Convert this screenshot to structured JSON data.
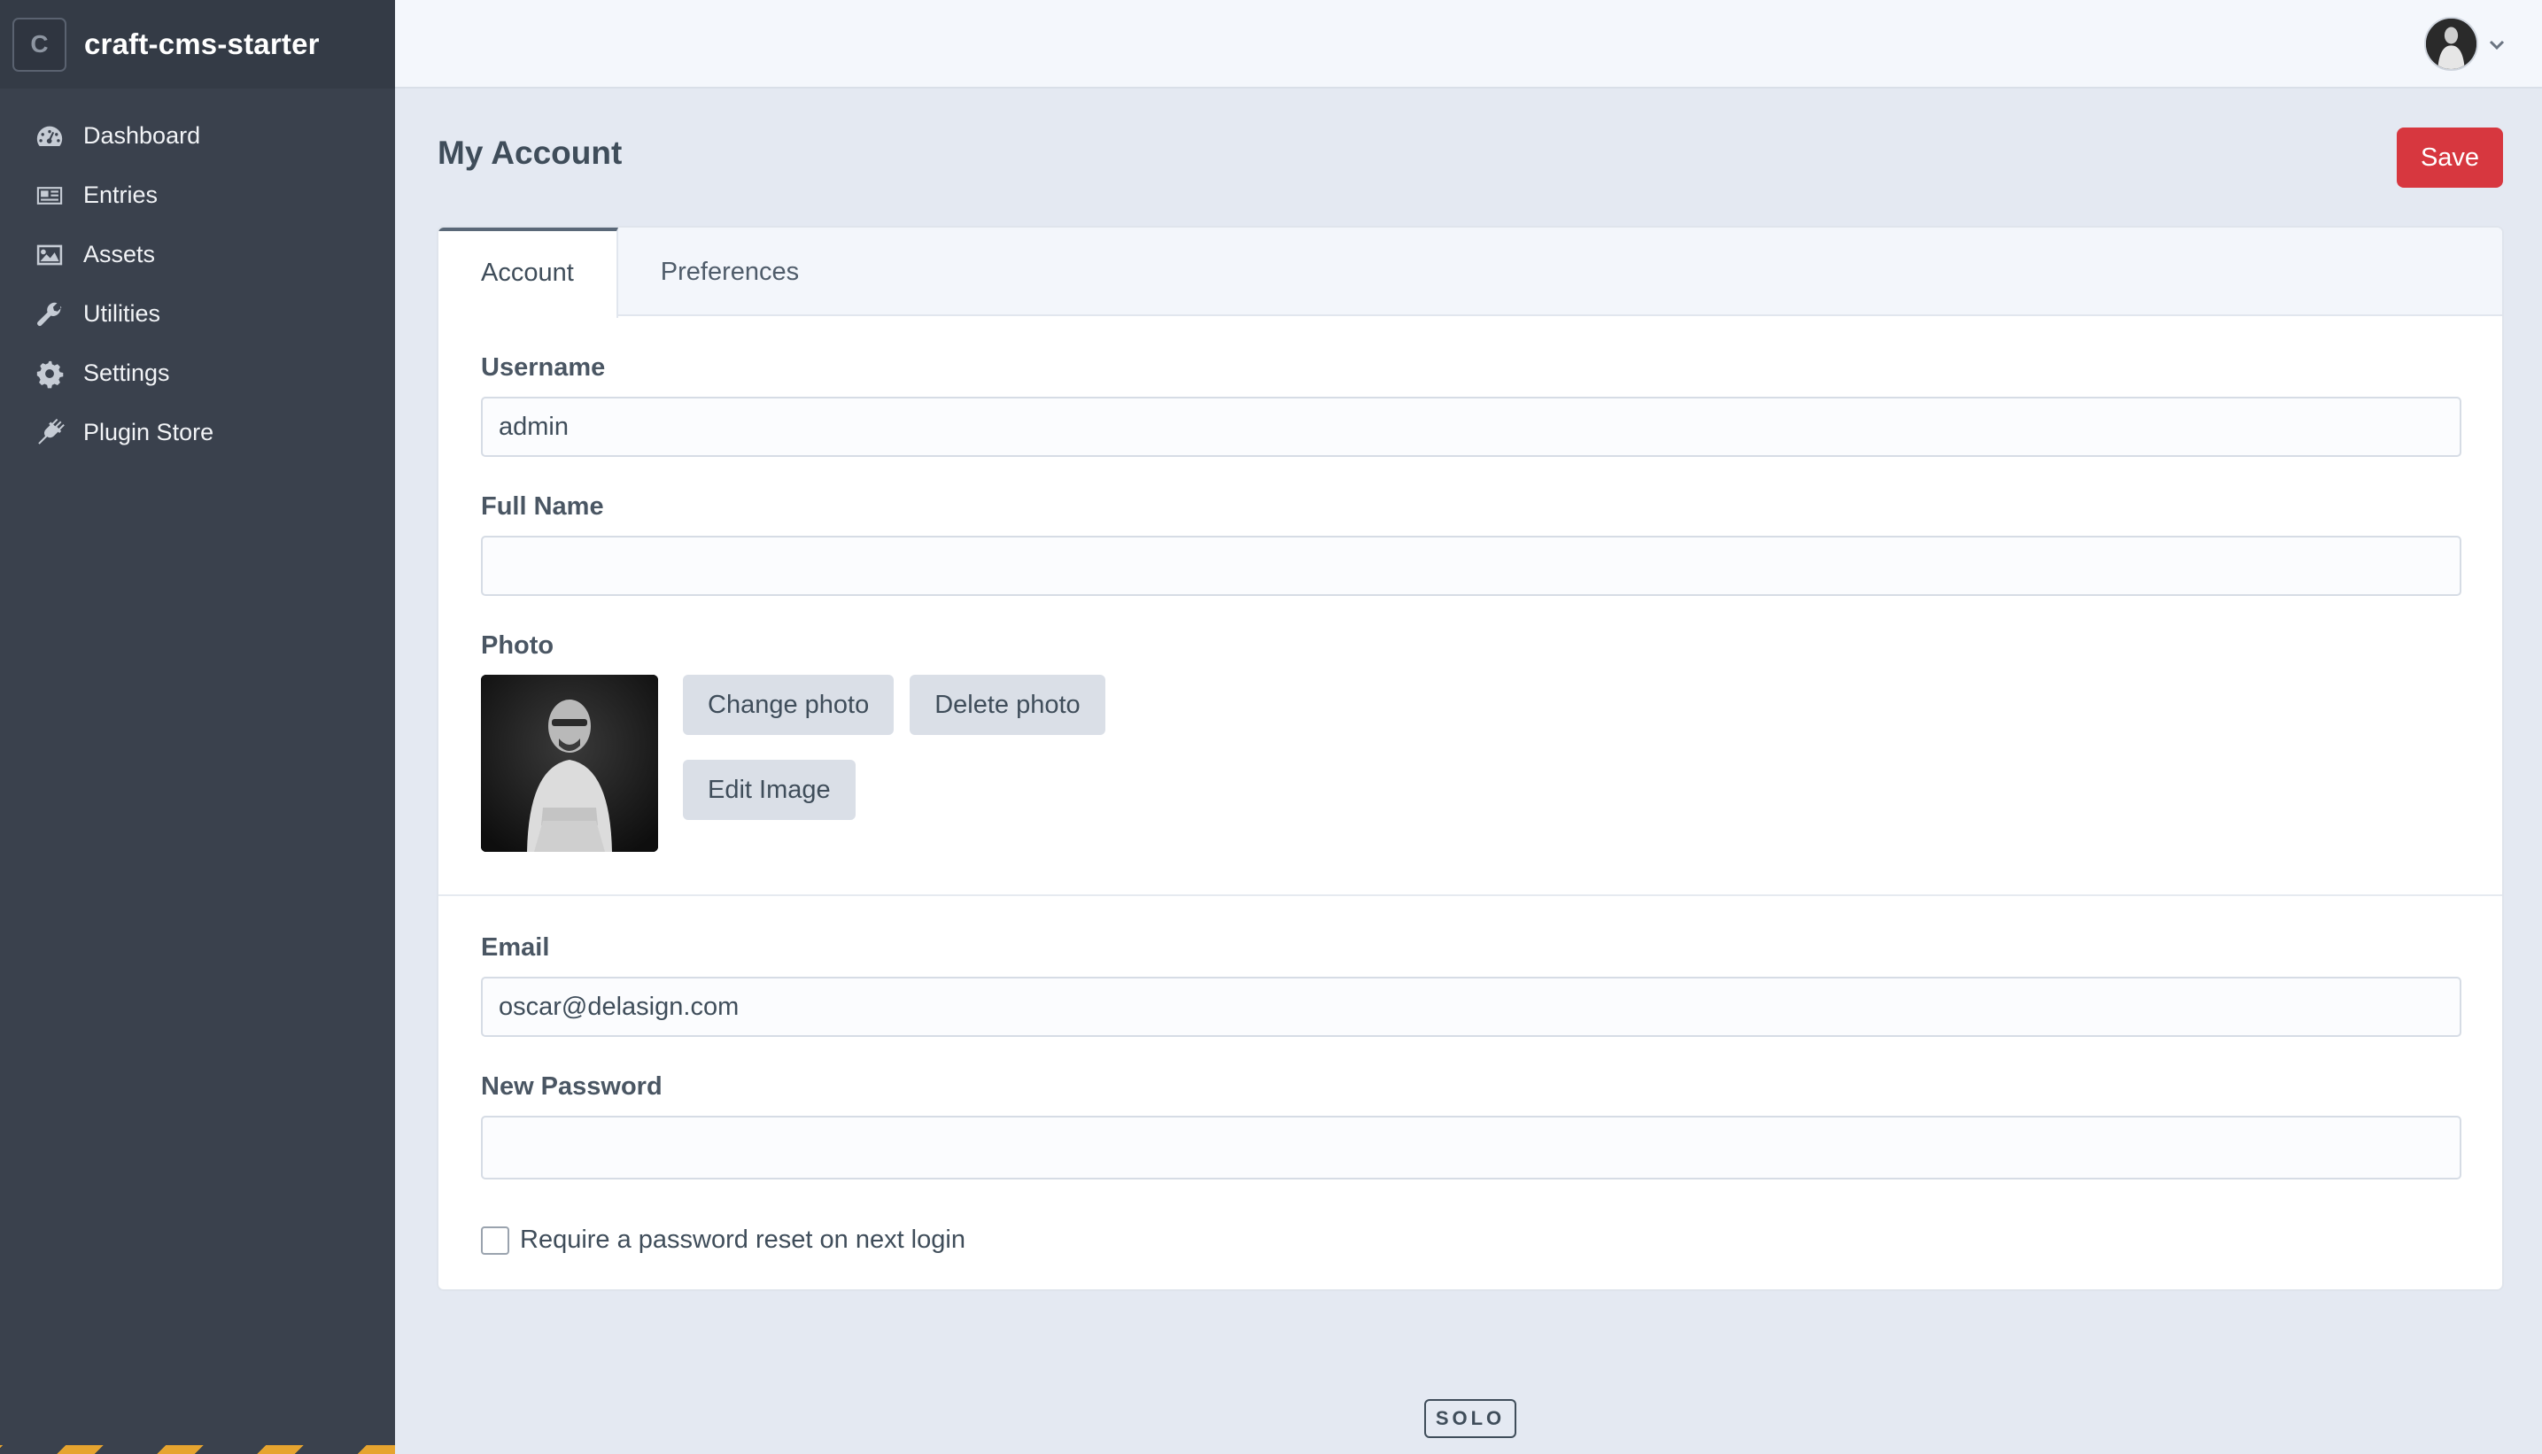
{
  "site": {
    "logo_letter": "C",
    "name": "craft-cms-starter"
  },
  "nav": {
    "items": [
      {
        "label": "Dashboard",
        "icon": "gauge-icon"
      },
      {
        "label": "Entries",
        "icon": "newspaper-icon"
      },
      {
        "label": "Assets",
        "icon": "image-icon"
      },
      {
        "label": "Utilities",
        "icon": "wrench-icon"
      },
      {
        "label": "Settings",
        "icon": "gear-icon"
      },
      {
        "label": "Plugin Store",
        "icon": "plug-icon"
      }
    ]
  },
  "page": {
    "title": "My Account",
    "save_label": "Save"
  },
  "tabs": [
    {
      "label": "Account",
      "active": true
    },
    {
      "label": "Preferences",
      "active": false
    }
  ],
  "form": {
    "username": {
      "label": "Username",
      "value": "admin"
    },
    "full_name": {
      "label": "Full Name",
      "value": ""
    },
    "photo": {
      "label": "Photo",
      "change_label": "Change photo",
      "delete_label": "Delete photo",
      "edit_label": "Edit Image"
    },
    "email": {
      "label": "Email",
      "value": "oscar@delasign.com"
    },
    "new_password": {
      "label": "New Password",
      "value": ""
    },
    "require_reset": {
      "label": "Require a password reset on next login",
      "checked": false
    }
  },
  "footer": {
    "edition": "SOLO"
  },
  "colors": {
    "accent": "#d7373f",
    "sidebar": "#3a414d",
    "background": "#e4e9f2"
  }
}
